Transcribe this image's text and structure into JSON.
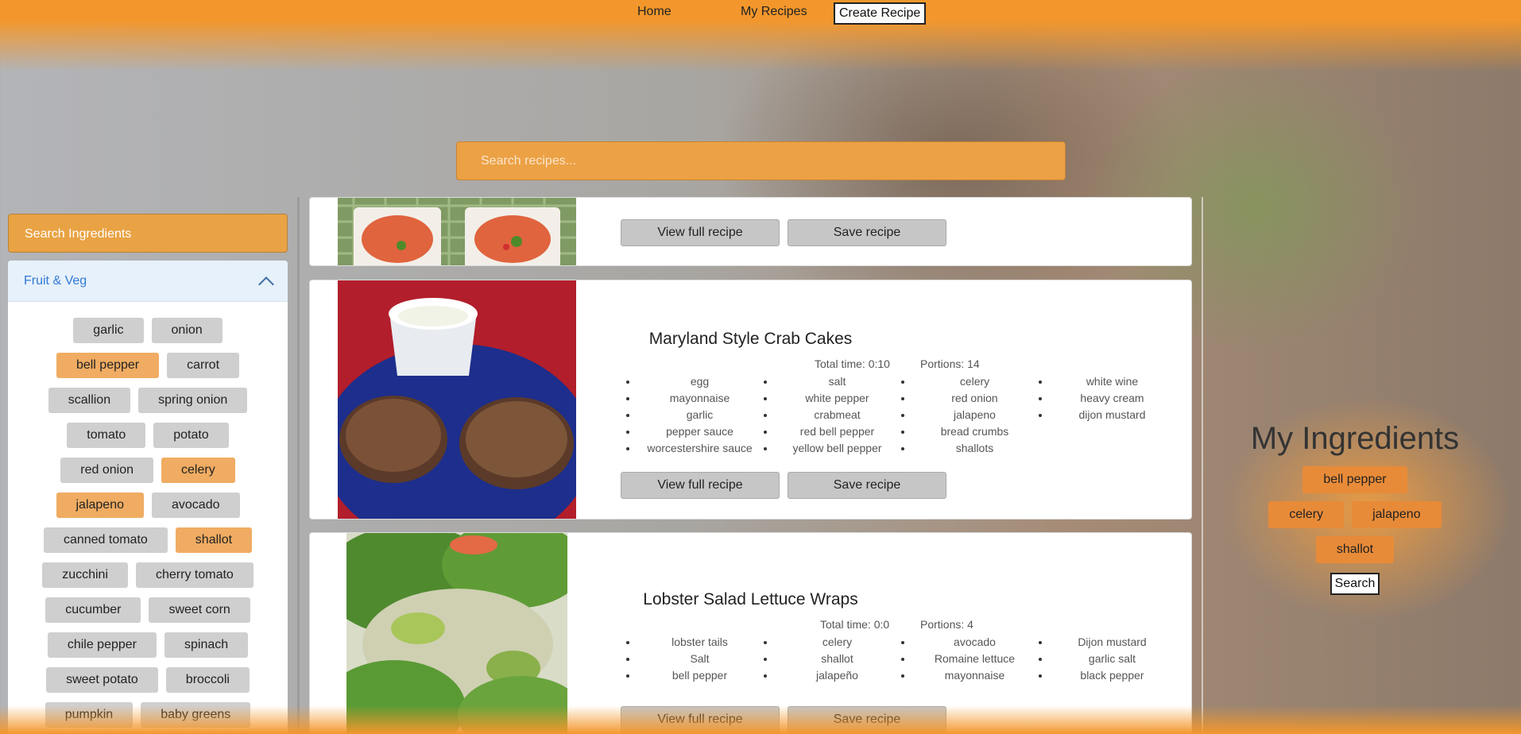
{
  "nav": {
    "home": "Home",
    "my_recipes": "My Recipes",
    "create": "Create Recipe"
  },
  "search": {
    "placeholder": "Search recipes..."
  },
  "sidebar": {
    "search_label": "Search Ingredients",
    "category": "Fruit & Veg",
    "chips": [
      {
        "label": "garlic",
        "selected": false
      },
      {
        "label": "onion",
        "selected": false
      },
      {
        "label": "bell pepper",
        "selected": true
      },
      {
        "label": "carrot",
        "selected": false
      },
      {
        "label": "scallion",
        "selected": false
      },
      {
        "label": "spring onion",
        "selected": false
      },
      {
        "label": "tomato",
        "selected": false
      },
      {
        "label": "potato",
        "selected": false
      },
      {
        "label": "red onion",
        "selected": false
      },
      {
        "label": "celery",
        "selected": true
      },
      {
        "label": "jalapeno",
        "selected": true
      },
      {
        "label": "avocado",
        "selected": false
      },
      {
        "label": "canned tomato",
        "selected": false
      },
      {
        "label": "shallot",
        "selected": true
      },
      {
        "label": "zucchini",
        "selected": false
      },
      {
        "label": "cherry tomato",
        "selected": false
      },
      {
        "label": "cucumber",
        "selected": false
      },
      {
        "label": "sweet corn",
        "selected": false
      },
      {
        "label": "chile pepper",
        "selected": false
      },
      {
        "label": "spinach",
        "selected": false
      },
      {
        "label": "sweet potato",
        "selected": false
      },
      {
        "label": "broccoli",
        "selected": false
      },
      {
        "label": "pumpkin",
        "selected": false
      },
      {
        "label": "baby greens",
        "selected": false
      }
    ]
  },
  "recipes": {
    "view_label": "View full recipe",
    "save_label": "Save recipe",
    "r2": {
      "title": "Maryland Style Crab Cakes",
      "total_time": "Total time: 0:10",
      "portions": "Portions: 14",
      "cols": [
        [
          "egg",
          "mayonnaise",
          "garlic",
          "pepper sauce",
          "worcestershire sauce"
        ],
        [
          "salt",
          "white pepper",
          "crabmeat",
          "red bell pepper",
          "yellow bell pepper"
        ],
        [
          "celery",
          "red onion",
          "jalapeno",
          "bread crumbs",
          "shallots"
        ],
        [
          "white wine",
          "heavy cream",
          "dijon mustard"
        ]
      ]
    },
    "r3": {
      "title": "Lobster Salad Lettuce Wraps",
      "total_time": "Total time: 0:0",
      "portions": "Portions: 4",
      "cols": [
        [
          "lobster tails",
          "Salt",
          "bell pepper"
        ],
        [
          "celery",
          "shallot",
          "jalapeño"
        ],
        [
          "avocado",
          "Romaine lettuce",
          "mayonnaise"
        ],
        [
          "Dijon mustard",
          "garlic salt",
          "black pepper"
        ]
      ]
    }
  },
  "my_ingredients": {
    "title": "My Ingredients",
    "items": [
      "bell pepper",
      "celery",
      "jalapeno",
      "shallot"
    ],
    "search_label": "Search"
  }
}
